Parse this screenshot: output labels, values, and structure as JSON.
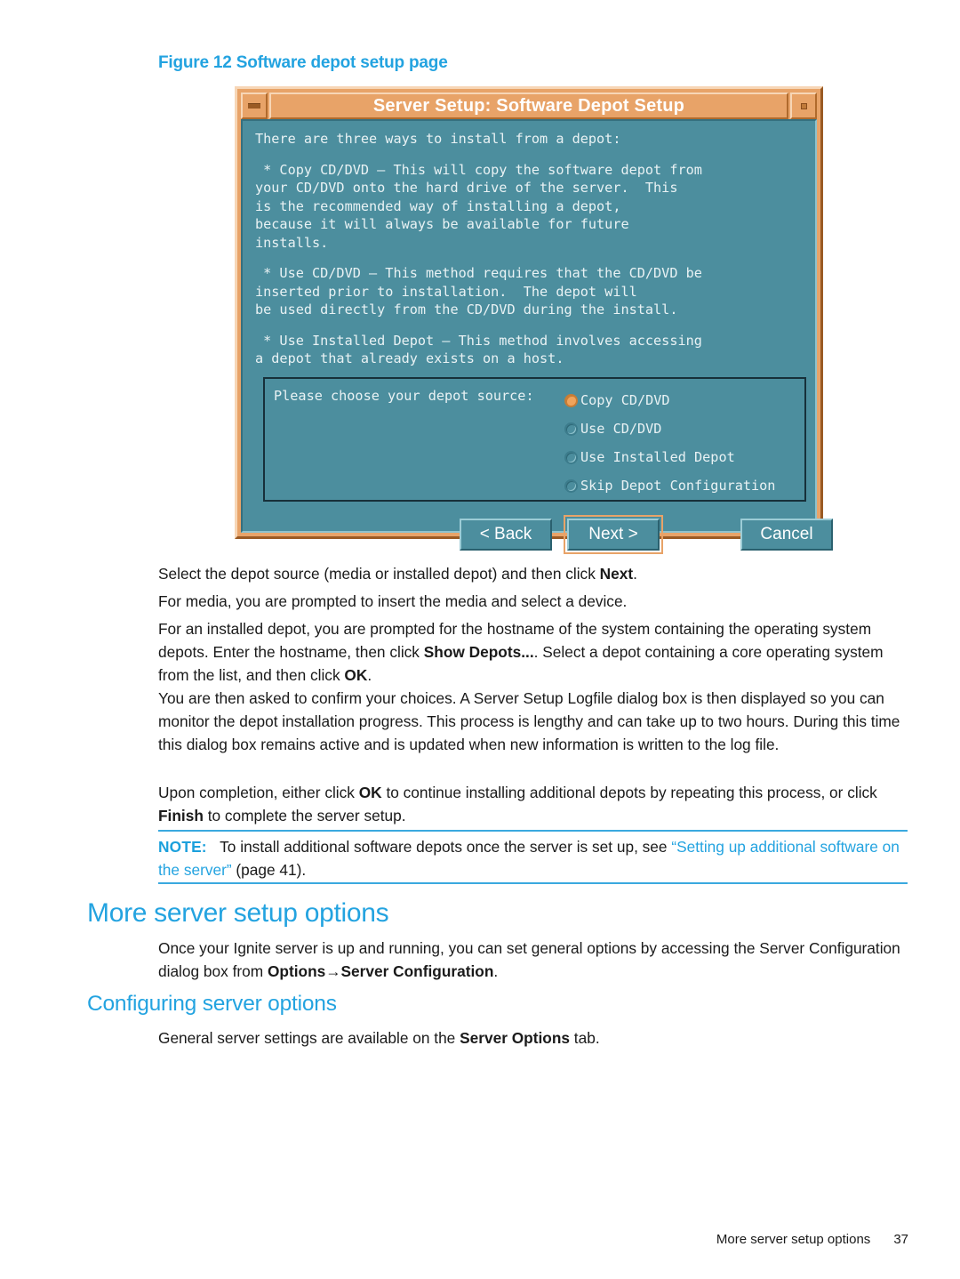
{
  "figure": {
    "caption": "Figure 12 Software depot setup page"
  },
  "dialog": {
    "title": "Server Setup: Software Depot Setup",
    "minimize_icon": "minimize-icon",
    "maximize_icon": "maximize-icon",
    "intro": "There are three ways to install from a depot:",
    "paragraphs": [
      " * Copy CD/DVD – This will copy the software depot from\nyour CD/DVD onto the hard drive of the server.  This\nis the recommended way of installing a depot,\nbecause it will always be available for future\ninstalls.",
      " * Use CD/DVD – This method requires that the CD/DVD be\ninserted prior to installation.  The depot will\nbe used directly from the CD/DVD during the install.",
      " * Use Installed Depot – This method involves accessing\na depot that already exists on a host."
    ],
    "prompt": "Please choose your depot source:",
    "options": [
      {
        "label": "Copy CD/DVD",
        "selected": true
      },
      {
        "label": "Use CD/DVD",
        "selected": false
      },
      {
        "label": "Use Installed Depot",
        "selected": false
      },
      {
        "label": "Skip Depot Configuration",
        "selected": false
      }
    ],
    "buttons": {
      "back": "< Back",
      "next": "Next >",
      "cancel": "Cancel"
    }
  },
  "content": {
    "p1_pre": "Select the depot source (media or installed depot) and then click ",
    "p1_bold": "Next",
    "p1_post": ".",
    "p2": "For media, you are prompted to insert the media and select a device.",
    "p3_pre": "For an installed depot, you are prompted for the hostname of the system containing the operating system depots. Enter the hostname, then click ",
    "p3_bold1": "Show Depots...",
    "p3_mid": ". Select a depot containing a core operating system from the list, and then click ",
    "p3_bold2": "OK",
    "p3_post": ".",
    "p4": "You are then asked to confirm your choices. A Server Setup Logfile dialog box is then displayed so you can monitor the depot installation progress. This process is lengthy and can take up to two hours. During this time this dialog box remains active and is updated when new information is written to the log file.",
    "p5_pre": "Upon completion, either click ",
    "p5_bold1": "OK",
    "p5_mid": " to continue installing additional depots by repeating this process, or click ",
    "p5_bold2": "Finish",
    "p5_post": " to complete the server setup."
  },
  "note": {
    "label": "NOTE:",
    "text_before": "To install additional software depots once the server is set up, see ",
    "link": "“Setting up additional software on the server”",
    "text_after": " (page 41)."
  },
  "headings": {
    "h1": "More server setup options",
    "h2": "Configuring server options"
  },
  "sections": {
    "more_options_pre": "Once your Ignite server is up and running, you can set general options by accessing the Server Configuration dialog box from ",
    "more_options_bold1": "Options",
    "more_options_arrow": "→",
    "more_options_bold2": "Server Configuration",
    "more_options_post": ".",
    "configuring_pre": "General server settings are available on the ",
    "configuring_bold": "Server Options",
    "configuring_post": " tab."
  },
  "footer": {
    "section": "More server setup options",
    "page": "37"
  },
  "colors": {
    "accent_blue": "#23A3E0",
    "dialog_orange": "#E8A368",
    "dialog_teal": "#4C8E9E"
  }
}
